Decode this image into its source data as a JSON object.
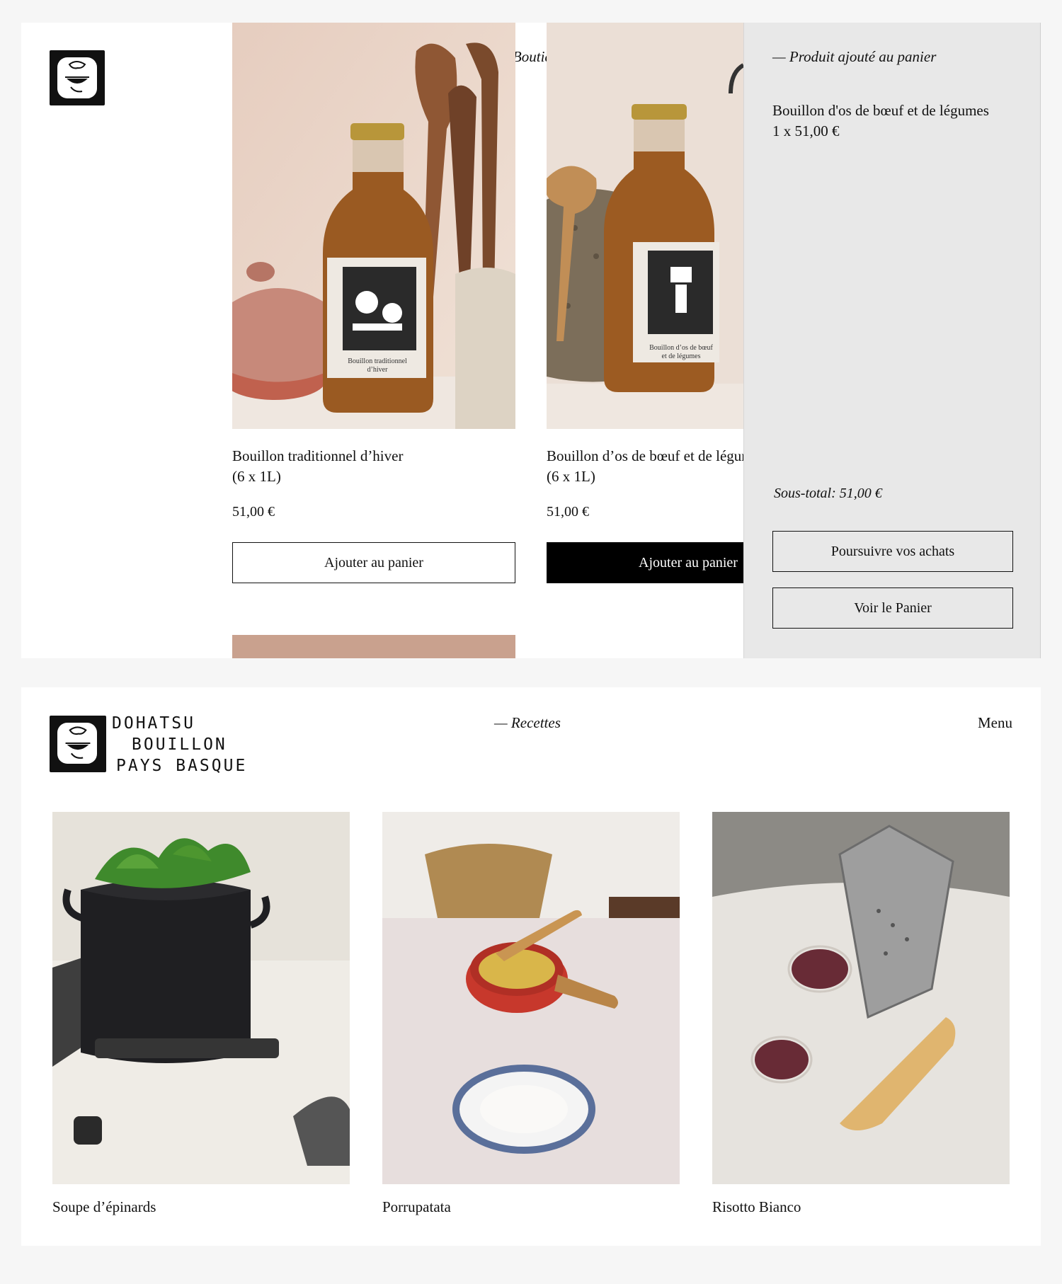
{
  "shop": {
    "section_title": "— Boutique",
    "products": [
      {
        "name_line1": "Bouillon traditionnel d’hiver",
        "name_line2": "(6 x 1L)",
        "price": "51,00 €",
        "button_label": "Ajouter au panier",
        "image_icon": "broth-bottle-illustrated-label",
        "label_text": "Bouillon traditionnel d’hiver"
      },
      {
        "name_line1": "Bouillon d’os de bœuf et de légumes",
        "name_line2": "(6 x 1L)",
        "price": "51,00 €",
        "button_label": "Ajouter au panier",
        "image_icon": "broth-bottle-illustrated-label",
        "label_text": "Bouillon d’os de bœuf et de légumes"
      }
    ]
  },
  "cart": {
    "heading": "— Produit ajouté au panier",
    "item_name": "Bouillon d'os de bœuf et de légumes",
    "item_qty_price": "1 x 51,00 €",
    "subtotal": "Sous-total: 51,00 €",
    "continue_label": "Poursuivre vos achats",
    "view_cart_label": "Voir le Panier"
  },
  "recipes_page": {
    "brand_lines": [
      "DOHATSU",
      "BOUILLON",
      "PAYS BASQUE"
    ],
    "section_title": "— Recettes",
    "menu_label": "Menu",
    "recipes": [
      {
        "name": "Soupe d’épinards",
        "image_icon": "pot-with-spinach"
      },
      {
        "name": "Porrupatata",
        "image_icon": "red-pan-potatoes"
      },
      {
        "name": "Risotto Bianco",
        "image_icon": "grater-wine-cheese"
      }
    ]
  },
  "colors": {
    "page_bg": "#f6f6f6",
    "panel_bg": "#e8e8e8",
    "ink": "#111111",
    "button_solid": "#000000"
  }
}
